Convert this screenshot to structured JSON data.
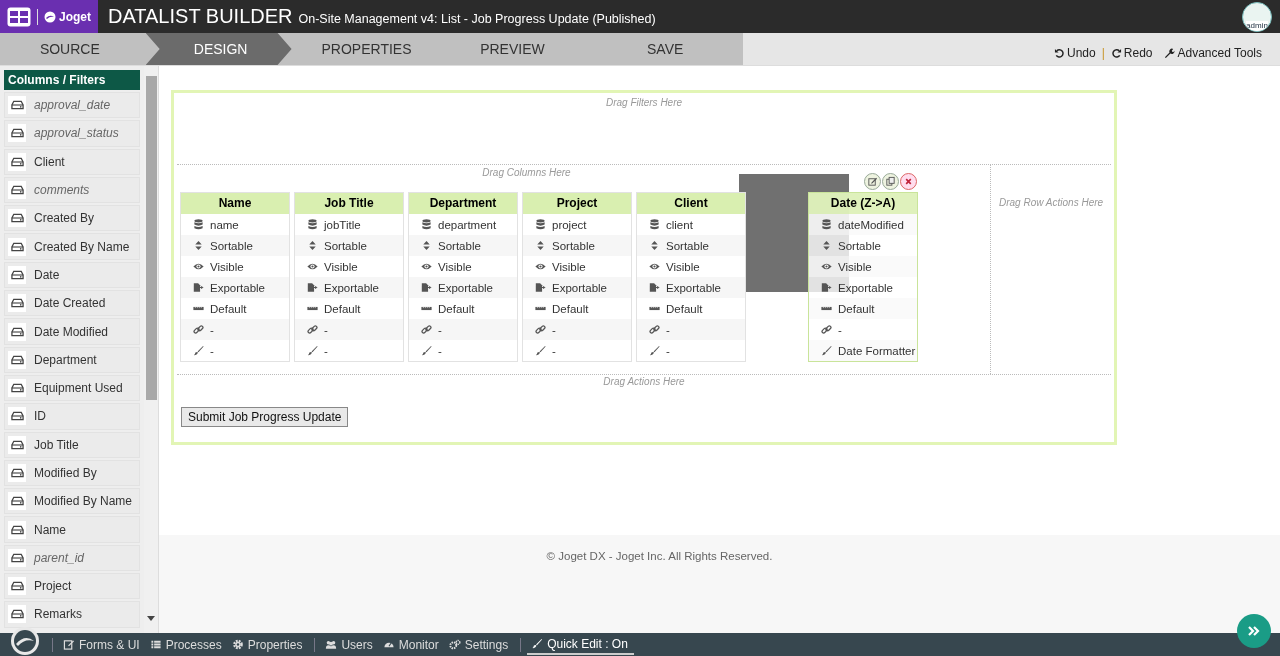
{
  "header": {
    "brand": "Joget",
    "title": "DATALIST BUILDER",
    "subtitle": "On-Site Management v4: List - Job Progress Update (Published)",
    "user": "admin"
  },
  "steps": [
    {
      "label": "SOURCE",
      "selected": false
    },
    {
      "label": "DESIGN",
      "selected": true
    },
    {
      "label": "PROPERTIES",
      "selected": false
    },
    {
      "label": "PREVIEW",
      "selected": false
    },
    {
      "label": "SAVE",
      "selected": false
    }
  ],
  "toolbar": {
    "undo": "Undo",
    "separator": "|",
    "redo": "Redo",
    "advanced": "Advanced Tools"
  },
  "sidebar": {
    "title": "Columns / Filters",
    "items": [
      {
        "label": "approval_date",
        "no_label": true
      },
      {
        "label": "approval_status",
        "no_label": true
      },
      {
        "label": "Client",
        "no_label": false
      },
      {
        "label": "comments",
        "no_label": true
      },
      {
        "label": "Created By",
        "no_label": false
      },
      {
        "label": "Created By Name",
        "no_label": false
      },
      {
        "label": "Date",
        "no_label": false
      },
      {
        "label": "Date Created",
        "no_label": false
      },
      {
        "label": "Date Modified",
        "no_label": false
      },
      {
        "label": "Department",
        "no_label": false
      },
      {
        "label": "Equipment Used",
        "no_label": false
      },
      {
        "label": "ID",
        "no_label": false
      },
      {
        "label": "Job Title",
        "no_label": false
      },
      {
        "label": "Modified By",
        "no_label": false
      },
      {
        "label": "Modified By Name",
        "no_label": false
      },
      {
        "label": "Name",
        "no_label": false
      },
      {
        "label": "parent_id",
        "no_label": true
      },
      {
        "label": "Project",
        "no_label": false
      },
      {
        "label": "Remarks",
        "no_label": false
      }
    ]
  },
  "canvas": {
    "filters_hint": "Drag Filters Here",
    "columns_hint": "Drag Columns Here",
    "row_actions_hint": "Drag Row Actions Here",
    "actions_hint": "Drag Actions Here",
    "columns": [
      {
        "title": "Name",
        "selected": false,
        "rows": [
          {
            "kind": "field",
            "text": "name"
          },
          {
            "kind": "sort",
            "text": "Sortable"
          },
          {
            "kind": "visible",
            "text": "Visible"
          },
          {
            "kind": "export",
            "text": "Exportable"
          },
          {
            "kind": "format",
            "text": "Default"
          },
          {
            "kind": "link",
            "text": "-"
          },
          {
            "kind": "formatter",
            "text": "-"
          }
        ]
      },
      {
        "title": "Job Title",
        "selected": false,
        "rows": [
          {
            "kind": "field",
            "text": "jobTitle"
          },
          {
            "kind": "sort",
            "text": "Sortable"
          },
          {
            "kind": "visible",
            "text": "Visible"
          },
          {
            "kind": "export",
            "text": "Exportable"
          },
          {
            "kind": "format",
            "text": "Default"
          },
          {
            "kind": "link",
            "text": "-"
          },
          {
            "kind": "formatter",
            "text": "-"
          }
        ]
      },
      {
        "title": "Department",
        "selected": false,
        "rows": [
          {
            "kind": "field",
            "text": "department"
          },
          {
            "kind": "sort",
            "text": "Sortable"
          },
          {
            "kind": "visible",
            "text": "Visible"
          },
          {
            "kind": "export",
            "text": "Exportable"
          },
          {
            "kind": "format",
            "text": "Default"
          },
          {
            "kind": "link",
            "text": "-"
          },
          {
            "kind": "formatter",
            "text": "-"
          }
        ]
      },
      {
        "title": "Project",
        "selected": false,
        "rows": [
          {
            "kind": "field",
            "text": "project"
          },
          {
            "kind": "sort",
            "text": "Sortable"
          },
          {
            "kind": "visible",
            "text": "Visible"
          },
          {
            "kind": "export",
            "text": "Exportable"
          },
          {
            "kind": "format",
            "text": "Default"
          },
          {
            "kind": "link",
            "text": "-"
          },
          {
            "kind": "formatter",
            "text": "-"
          }
        ]
      },
      {
        "title": "Client",
        "selected": false,
        "rows": [
          {
            "kind": "field",
            "text": "client"
          },
          {
            "kind": "sort",
            "text": "Sortable"
          },
          {
            "kind": "visible",
            "text": "Visible"
          },
          {
            "kind": "export",
            "text": "Exportable"
          },
          {
            "kind": "format",
            "text": "Default"
          },
          {
            "kind": "link",
            "text": "-"
          },
          {
            "kind": "formatter",
            "text": "-"
          }
        ]
      },
      {
        "title": "Date (Z->A)",
        "selected": true,
        "rows": [
          {
            "kind": "field",
            "text": "dateModified"
          },
          {
            "kind": "sort",
            "text": "Sortable"
          },
          {
            "kind": "visible",
            "text": "Visible"
          },
          {
            "kind": "export",
            "text": "Exportable"
          },
          {
            "kind": "format",
            "text": "Default"
          },
          {
            "kind": "link",
            "text": "-"
          },
          {
            "kind": "formatter",
            "text": "Date Formatter"
          }
        ]
      }
    ],
    "actions": [
      {
        "label": "Submit Job Progress Update"
      }
    ]
  },
  "footer": "© Joget DX - Joget Inc. All Rights Reserved.",
  "bottom_bar": [
    {
      "kind": "forms",
      "label": "Forms & UI",
      "selected": false
    },
    {
      "kind": "processes",
      "label": "Processes",
      "selected": false
    },
    {
      "kind": "properties",
      "label": "Properties",
      "selected": false
    },
    {
      "kind": "users",
      "label": "Users",
      "selected": false
    },
    {
      "kind": "monitor",
      "label": "Monitor",
      "selected": false
    },
    {
      "kind": "settings",
      "label": "Settings",
      "selected": false
    },
    {
      "kind": "quickedit",
      "label": "Quick Edit : On",
      "selected": true
    }
  ]
}
